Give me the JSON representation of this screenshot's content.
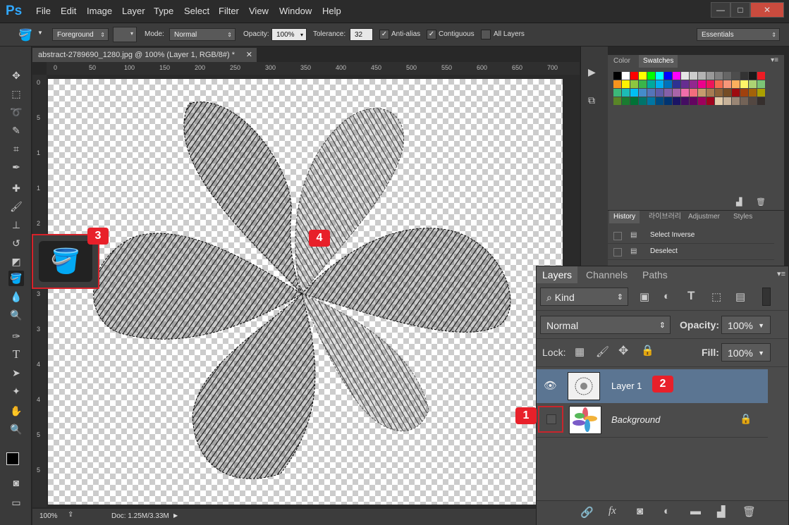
{
  "app": {
    "logo": "Ps"
  },
  "menu": [
    "File",
    "Edit",
    "Image",
    "Layer",
    "Type",
    "Select",
    "Filter",
    "View",
    "Window",
    "Help"
  ],
  "window_buttons": {
    "minimize": "—",
    "maximize": "□",
    "close": "✕"
  },
  "options": {
    "fill_source": "Foreground",
    "mode_label": "Mode:",
    "mode_value": "Normal",
    "opacity_label": "Opacity:",
    "opacity_value": "100%",
    "tolerance_label": "Tolerance:",
    "tolerance_value": "32",
    "antialias_label": "Anti-alias",
    "contiguous_label": "Contiguous",
    "all_layers_label": "All Layers",
    "workspace": "Essentials"
  },
  "document": {
    "tab_title": "abstract-2789690_1280.jpg @ 100% (Layer 1, RGB/8#) *",
    "ruler_h": [
      "0",
      "50",
      "100",
      "150",
      "200",
      "250",
      "300",
      "350",
      "400",
      "450",
      "500",
      "550",
      "600",
      "650",
      "700"
    ],
    "ruler_v": [
      "0",
      "5",
      "1",
      "1",
      "2",
      "2",
      "3",
      "3",
      "4",
      "4",
      "5",
      "5"
    ],
    "zoom": "100%",
    "doc_info": "Doc: 1.25M/3.33M"
  },
  "swatches_panel": {
    "tabs": [
      "Color",
      "Swatches"
    ],
    "colors": [
      "#000000",
      "#ffffff",
      "#ff0000",
      "#ffff00",
      "#00ff00",
      "#00ffff",
      "#0000ff",
      "#ff00ff",
      "#e6e6e6",
      "#cccccc",
      "#b3b3b3",
      "#999999",
      "#808080",
      "#666666",
      "#4d4d4d",
      "#333333",
      "#1a1a1a",
      "#ed1c24",
      "#f7941d",
      "#fff200",
      "#8dc63f",
      "#39b54a",
      "#00a99d",
      "#00aeef",
      "#0072bc",
      "#2e3192",
      "#662d91",
      "#92278f",
      "#ec008c",
      "#ed145b",
      "#f26c4f",
      "#f69679",
      "#fbaf5d",
      "#fff568",
      "#acd373",
      "#7cc576",
      "#3cb878",
      "#1cbbb4",
      "#00bff3",
      "#448ccb",
      "#5574b9",
      "#605ca8",
      "#8560a8",
      "#a864a8",
      "#f06eaa",
      "#f26d7d",
      "#c69c6d",
      "#a67c52",
      "#8c6239",
      "#754c24",
      "#9e0b0f",
      "#a0410d",
      "#a36209",
      "#aba000",
      "#598527",
      "#1a7b30",
      "#007236",
      "#00746b",
      "#0076a3",
      "#004a80",
      "#003471",
      "#1b1464",
      "#440e62",
      "#630460",
      "#9e005d",
      "#a0041e",
      "#e2cba9",
      "#c7b299",
      "#998675",
      "#736357",
      "#534741",
      "#362f2d"
    ]
  },
  "history_panel": {
    "tabs": [
      "History",
      "라이브러리",
      "Adjustmer",
      "Styles"
    ],
    "items": [
      "Select Inverse",
      "Deselect"
    ]
  },
  "layers_panel": {
    "tabs": [
      "Layers",
      "Channels",
      "Paths"
    ],
    "filter": "Kind",
    "blend_mode": "Normal",
    "opacity_label": "Opacity:",
    "opacity_value": "100%",
    "lock_label": "Lock:",
    "fill_label": "Fill:",
    "fill_value": "100%",
    "layers": [
      {
        "name": "Layer 1",
        "visible": true,
        "selected": true
      },
      {
        "name": "Background",
        "visible": false,
        "locked": true
      }
    ]
  },
  "callouts": [
    "1",
    "2",
    "3",
    "4"
  ]
}
